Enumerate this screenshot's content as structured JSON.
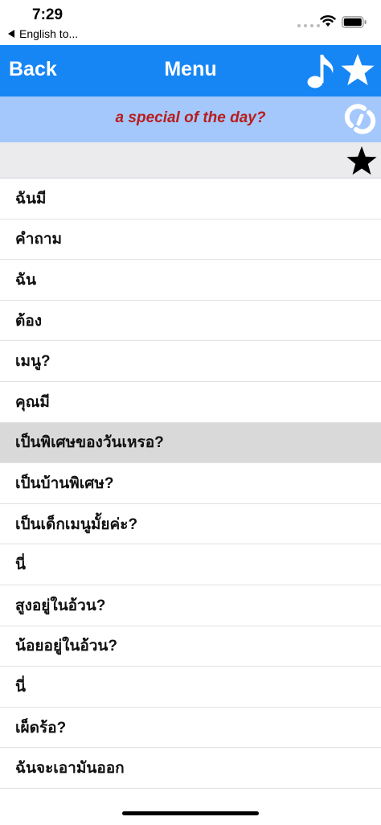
{
  "status_bar": {
    "time": "7:29",
    "back_app": "English to..."
  },
  "nav": {
    "back_label": "Back",
    "title": "Menu",
    "color": "#1786f5"
  },
  "banner": {
    "text": "a special of the day?",
    "text_color": "#b81d1d",
    "background": "#a4c8fb"
  },
  "phrases": [
    {
      "text": "ฉันมี",
      "selected": false
    },
    {
      "text": "คำถาม",
      "selected": false
    },
    {
      "text": "ฉัน",
      "selected": false
    },
    {
      "text": "ต้อง",
      "selected": false
    },
    {
      "text": "เมนู?",
      "selected": false
    },
    {
      "text": "คุณมี",
      "selected": false
    },
    {
      "text": "เป็นพิเศษของวันเหรอ?",
      "selected": true
    },
    {
      "text": "เป็นบ้านพิเศษ?",
      "selected": false
    },
    {
      "text": "เป็นเด็กเมนูมั้ยค่ะ?",
      "selected": false
    },
    {
      "text": "นี่",
      "selected": false
    },
    {
      "text": "สูงอยู่ในอ้วน?",
      "selected": false
    },
    {
      "text": "น้อยอยู่ในอ้วน?",
      "selected": false
    },
    {
      "text": "นี่",
      "selected": false
    },
    {
      "text": "เผ็ดร้อ?",
      "selected": false
    },
    {
      "text": "ฉันจะเอามันออก",
      "selected": false
    }
  ],
  "icons": {
    "wifi": "wifi-icon",
    "battery": "battery-icon",
    "music": "music-note-icon",
    "favorite_nav": "star-icon",
    "refresh": "refresh-icon",
    "favorite_toggle": "star-icon"
  }
}
